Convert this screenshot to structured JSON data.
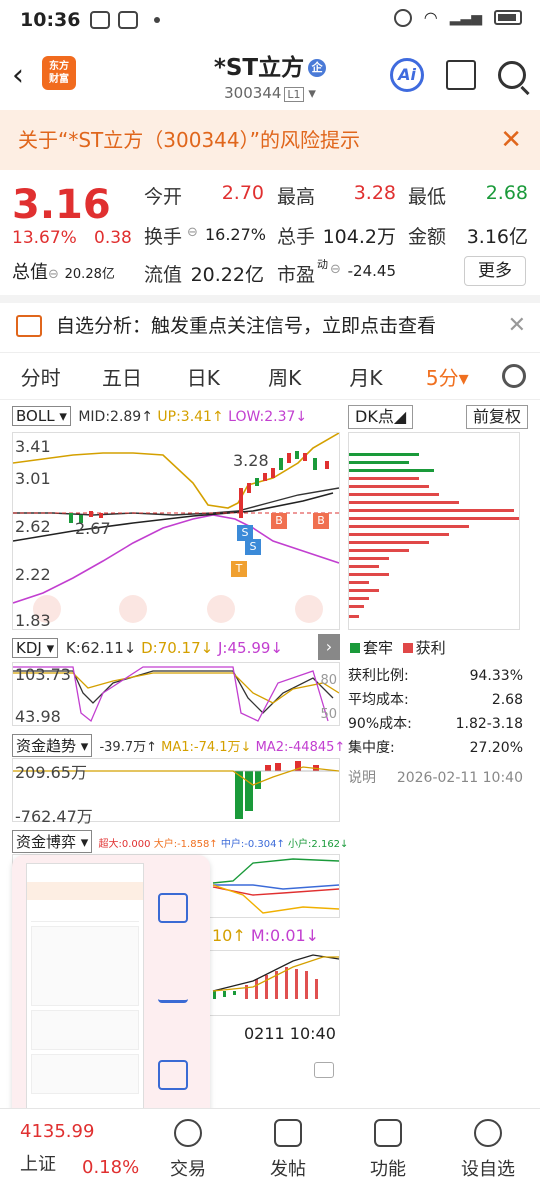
{
  "status_bar": {
    "time": "10:36"
  },
  "header": {
    "back_icon": "chevron-left-icon",
    "logo_text": "东方财富",
    "stock_name": "*ST立方",
    "company_badge": "企",
    "stock_code": "300344",
    "level_badge": "L1",
    "ai_label": "Ai"
  },
  "risk_banner": {
    "text": "关于“*ST立方（300344）”的风险提示",
    "close": "✕"
  },
  "quote": {
    "price": "3.16",
    "change_pct": "13.67%",
    "change": "0.38",
    "market_cap_label": "总值",
    "market_cap": "20.28亿",
    "open_label": "今开",
    "open": "2.70",
    "high_label": "最高",
    "high": "3.28",
    "low_label": "最低",
    "low": "2.68",
    "turnover_label": "换手",
    "turnover": "16.27%",
    "volume_label": "总手",
    "volume": "104.2万",
    "amount_label": "金额",
    "amount": "3.16亿",
    "float_cap_label": "流值",
    "float_cap": "20.22亿",
    "pe_label": "市盈",
    "pe_sup": "动",
    "pe": "-24.45",
    "more_label": "更多"
  },
  "alert": {
    "text": "自选分析：触发重点关注信号，立即点击查看",
    "close": "✕"
  },
  "tabs": [
    "分时",
    "五日",
    "日K",
    "周K",
    "月K",
    "5分▾"
  ],
  "boll": {
    "name": "BOLL",
    "mid": "MID:2.89↑",
    "up": "UP:3.41↑",
    "low": "LOW:2.37↓",
    "y_labels": [
      "3.41",
      "3.01",
      "2.62",
      "2.22",
      "1.83"
    ],
    "high_mark": "3.28",
    "low_mark": "2.67",
    "signals": [
      "B",
      "B",
      "S",
      "S",
      "T"
    ]
  },
  "kdj": {
    "name": "KDJ",
    "k": "K:62.11↓",
    "d": "D:70.17↓",
    "j": "J:45.99↓",
    "y_top": "103.73",
    "y_bottom": "43.98",
    "r80": "80",
    "r50": "50"
  },
  "fund_trend": {
    "name": "资金趋势",
    "v": "-39.7万↑",
    "ma1": "MA1:-74.1万↓",
    "ma2": "MA2:-44845↑",
    "y_top": "209.65万",
    "y_bottom": "-762.47万"
  },
  "fund_game": {
    "name": "资金博弈",
    "super": "超大:0.000",
    "big": "大户:-1.858↑",
    "mid": "中户:-0.304↑",
    "small": "小户:2.162↓"
  },
  "macd_frag": {
    "dif": "10↑",
    "m": "M:0.01↓",
    "time": "0211 10:40"
  },
  "dk_panel": {
    "dk_label": "DK点",
    "fq_label": "前复权",
    "legend_trap": "套牢",
    "legend_profit": "获利",
    "rows": [
      {
        "label": "获利比例:",
        "value": "94.33%"
      },
      {
        "label": "平均成本:",
        "value": "2.68"
      },
      {
        "label": "90%成本:",
        "value": "1.82-3.18"
      },
      {
        "label": "集中度:",
        "value": "27.20%"
      }
    ],
    "note_label": "说明",
    "note_time": "2026-02-11 10:40"
  },
  "bottom_nav": {
    "index_value": "4135.99",
    "index_name": "上证",
    "index_pct": "0.18%",
    "items": [
      "交易",
      "发帖",
      "功能",
      "设自选"
    ]
  },
  "colors": {
    "accent": "#f07020",
    "up": "#e03030",
    "down": "#1a9a3a",
    "brand": "#f16b1e"
  }
}
